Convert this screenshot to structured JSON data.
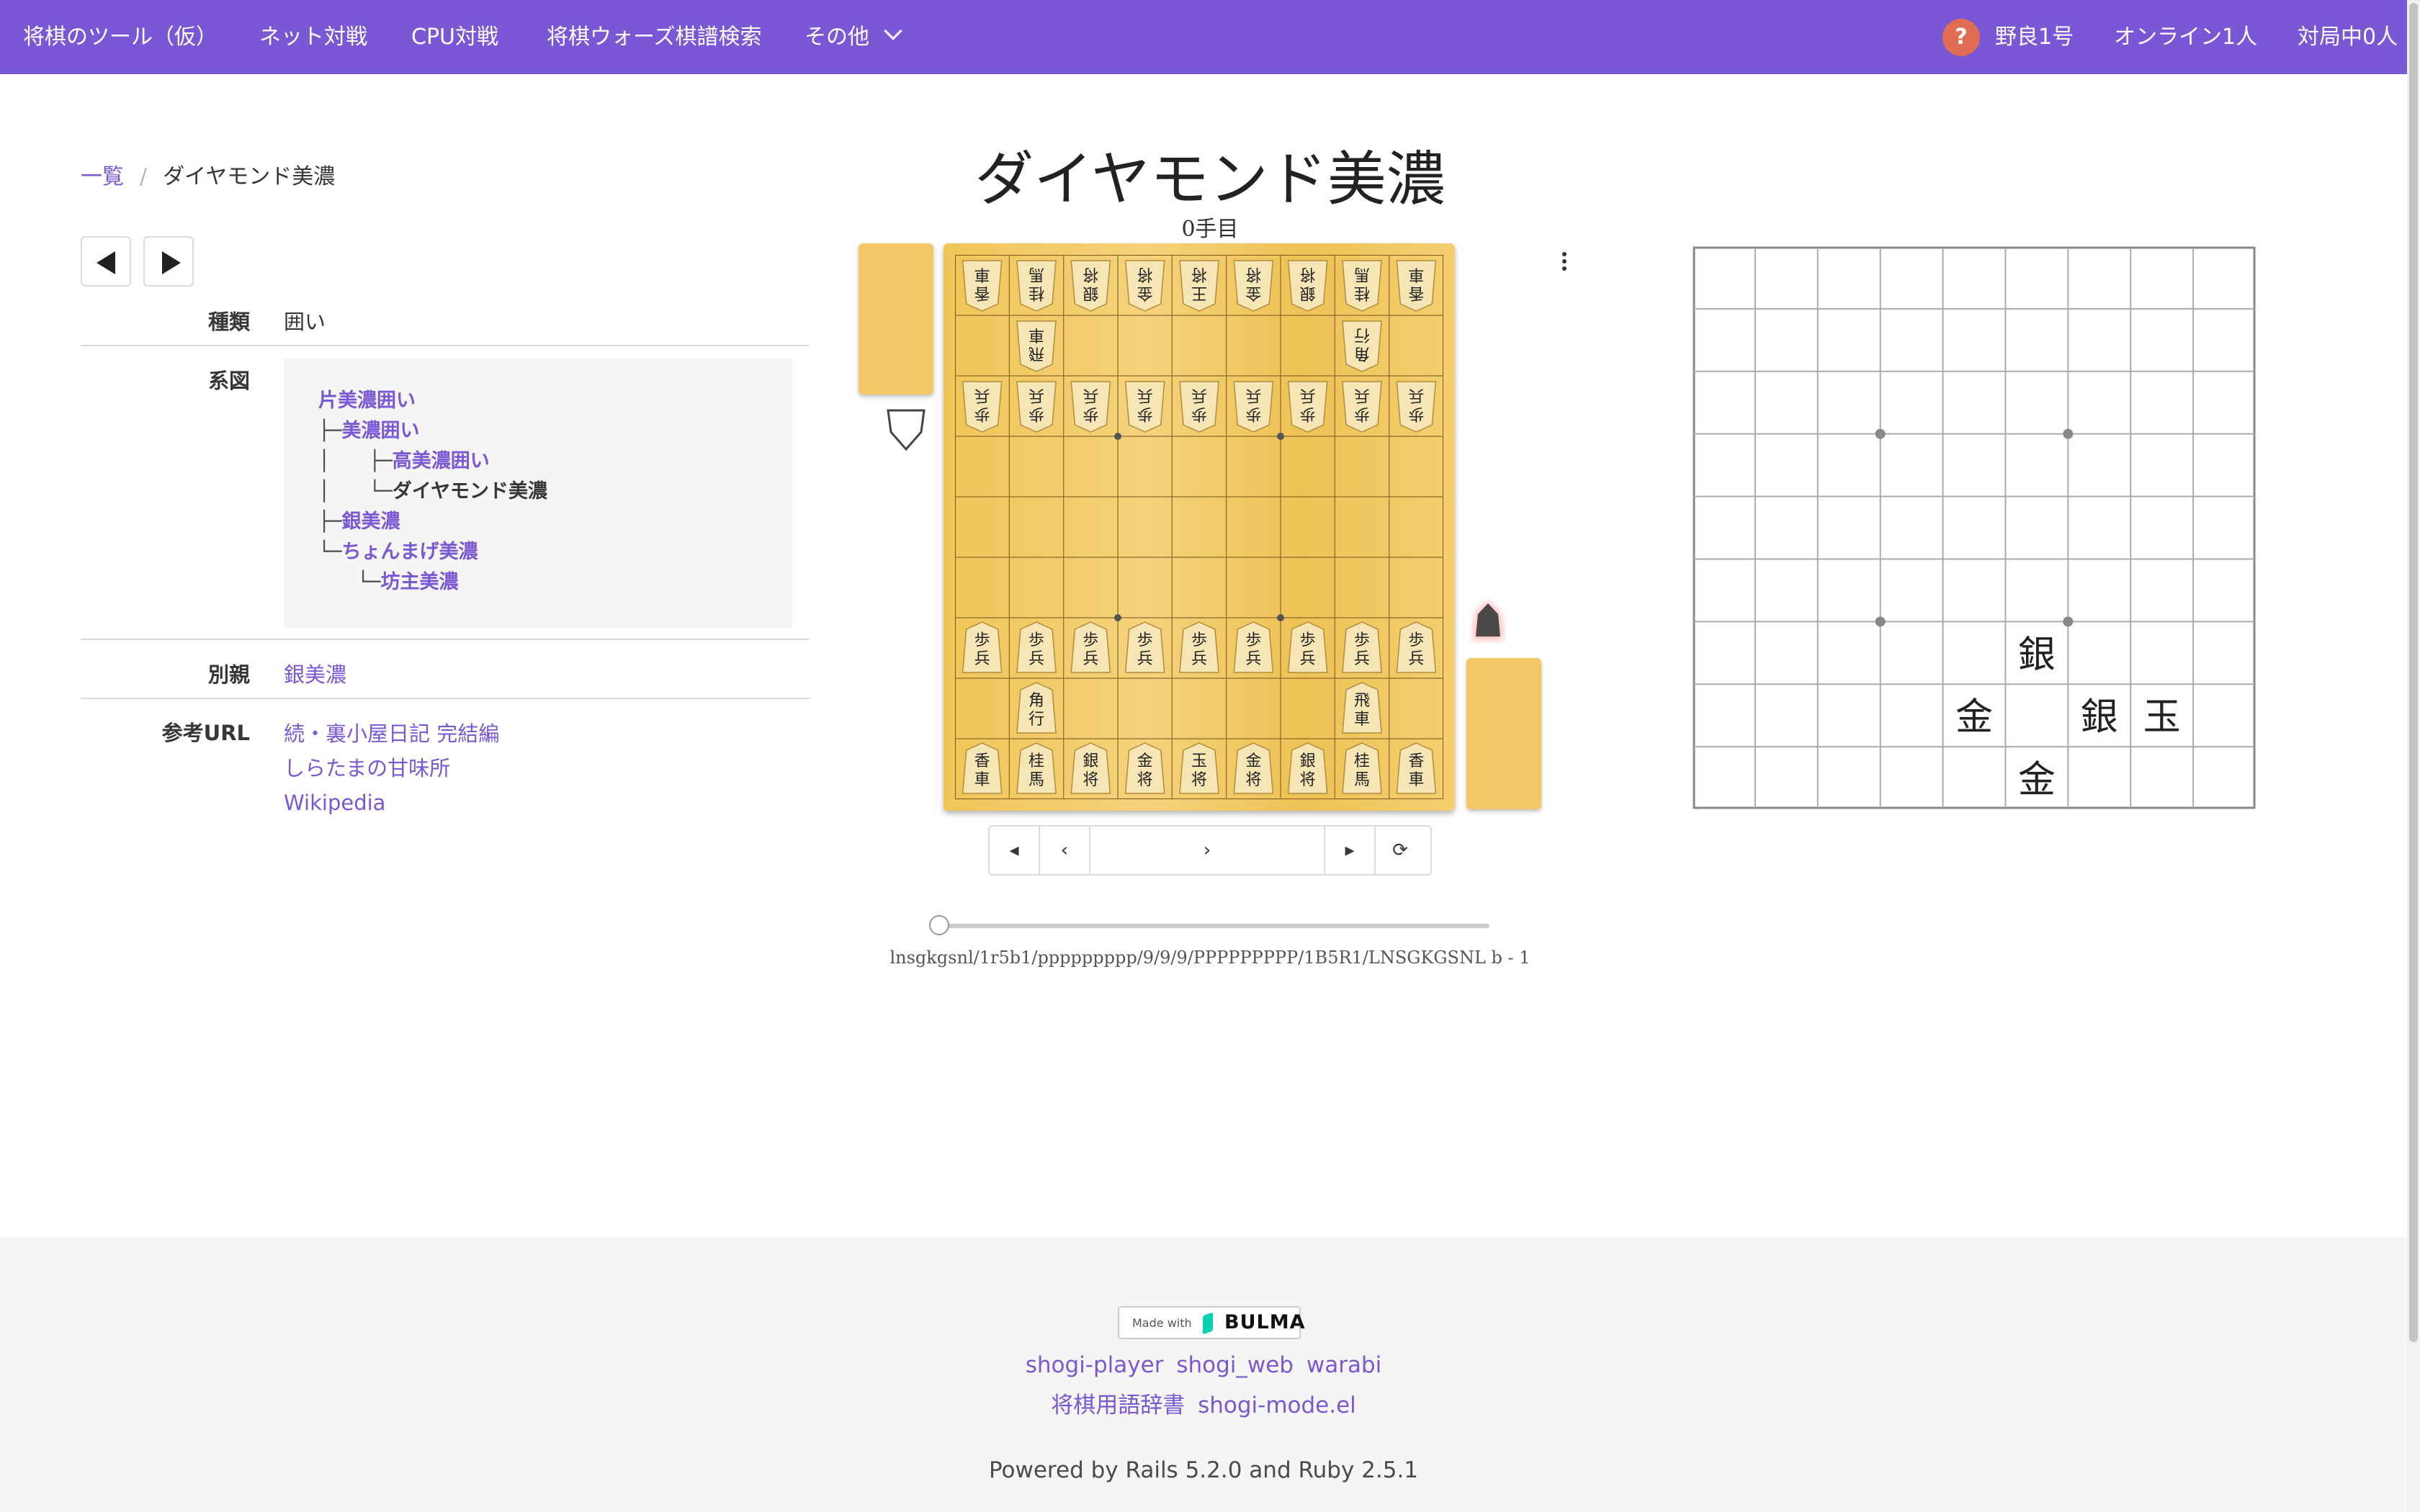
{
  "nav": {
    "brand": "将棋のツール（仮）",
    "items": [
      "ネット対戦",
      "CPU対戦",
      "将棋ウォーズ棋譜検索",
      "その他"
    ],
    "help_badge": "?",
    "user": "野良1号",
    "online": "オンライン1人",
    "playing": "対局中0人"
  },
  "breadcrumb": {
    "list": "一覧",
    "separator": "/",
    "current": "ダイヤモンド美濃"
  },
  "info": {
    "kind_label": "種類",
    "kind_value": "囲い",
    "tree_label": "系図",
    "tree": [
      {
        "prefix": "",
        "text": "片美濃囲い",
        "link": true
      },
      {
        "prefix": "├─",
        "text": "美濃囲い",
        "link": true
      },
      {
        "prefix": "│　　├─",
        "text": "高美濃囲い",
        "link": true
      },
      {
        "prefix": "│　　└─",
        "text": "ダイヤモンド美濃",
        "link": false
      },
      {
        "prefix": "├─",
        "text": "銀美濃",
        "link": true
      },
      {
        "prefix": "└─",
        "text": "ちょんまげ美濃",
        "link": true
      },
      {
        "prefix": "　　└─",
        "text": "坊主美濃",
        "link": true
      }
    ],
    "parent_label": "別親",
    "parent_value": "銀美濃",
    "url_label": "参考URL",
    "urls": [
      "続・裏小屋日記 完結編",
      "しらたまの甘味所",
      "Wikipedia"
    ]
  },
  "board": {
    "title": "ダイヤモンド美濃",
    "turn": "0手目",
    "gote_row1": [
      "香車",
      "桂馬",
      "銀将",
      "金将",
      "王将",
      "金将",
      "銀将",
      "桂馬",
      "香車"
    ],
    "gote_row2": [
      "",
      "飛車",
      "",
      "",
      "",
      "",
      "",
      "角行",
      ""
    ],
    "pawn": "歩兵",
    "sente_row8": [
      "",
      "角行",
      "",
      "",
      "",
      "",
      "",
      "飛車",
      ""
    ],
    "sente_row9": [
      "香車",
      "桂馬",
      "銀将",
      "金将",
      "玉将",
      "金将",
      "銀将",
      "桂馬",
      "香車"
    ],
    "controls": [
      "◂",
      "‹",
      "›",
      "▸",
      "⟳"
    ],
    "sfen": "lnsgkgsnl/1r5b1/ppppppppp/9/9/9/PPPPPPPPP/1B5R1/LNSGKGSNL b - 1"
  },
  "diagram": {
    "pieces": [
      {
        "file": 4,
        "rank": 7,
        "label": "銀"
      },
      {
        "file": 5,
        "rank": 8,
        "label": "金"
      },
      {
        "file": 3,
        "rank": 8,
        "label": "銀"
      },
      {
        "file": 2,
        "rank": 8,
        "label": "玉"
      },
      {
        "file": 4,
        "rank": 9,
        "label": "金"
      }
    ]
  },
  "footer": {
    "badge_small": "Made with",
    "badge_big": "BULMA",
    "links1": [
      "shogi-player",
      "shogi_web",
      "warabi"
    ],
    "links2": [
      "将棋用語辞書",
      "shogi-mode.el"
    ],
    "powered": "Powered by Rails 5.2.0 and Ruby 2.5.1"
  },
  "colors": {
    "accent": "#7957d5",
    "board": "#f0c558",
    "help": "#e06d53"
  }
}
